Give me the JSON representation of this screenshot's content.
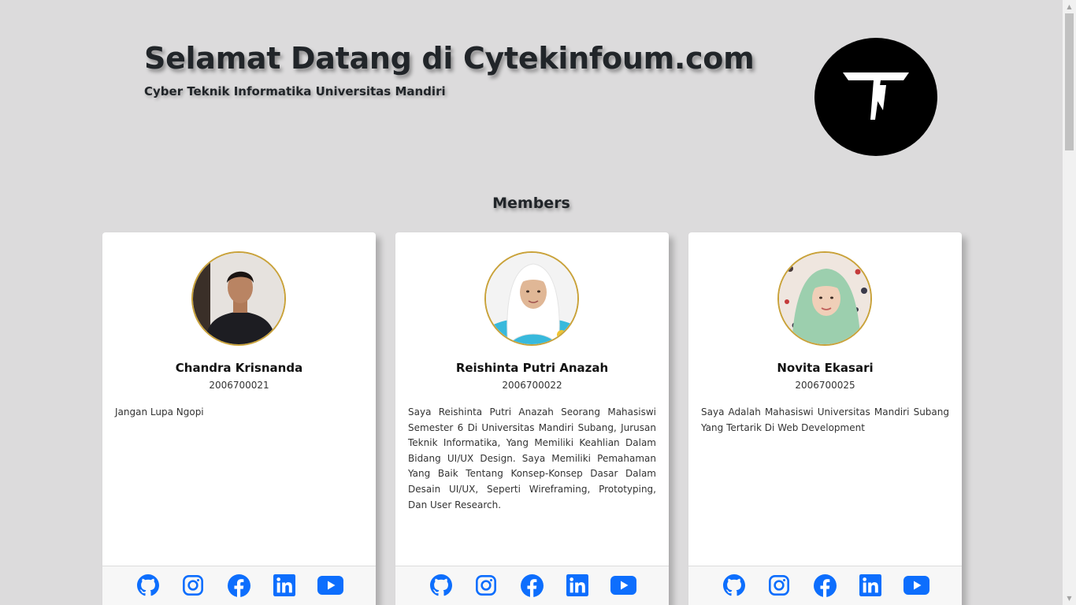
{
  "header": {
    "title": "Selamat Datang di Cytekinfoum.com",
    "subtitle": "Cyber Teknik Informatika Universitas Mandiri",
    "logo_icon": "ti-monogram-logo"
  },
  "members_section": {
    "title": "Members"
  },
  "members": [
    {
      "name": "Chandra Krisnanda",
      "nim": "2006700021",
      "bio": "Jangan Lupa Ngopi",
      "avatar": "photo-man-black-shirt"
    },
    {
      "name": "Reishinta Putri Anazah",
      "nim": "2006700022",
      "bio": "Saya Reishinta Putri Anazah Seorang Mahasiswi Semester 6 Di Universitas Mandiri Subang, Jurusan Teknik Informatika, Yang Memiliki Keahlian Dalam Bidang UI/UX Design. Saya Memiliki Pemahaman Yang Baik Tentang Konsep-Konsep Dasar Dalam Desain UI/UX, Seperti Wireframing, Prototyping, Dan User Research.",
      "avatar": "photo-woman-white-hijab"
    },
    {
      "name": "Novita Ekasari",
      "nim": "2006700025",
      "bio": "Saya Adalah Mahasiswi Universitas Mandiri Subang Yang Tertarik Di Web Development",
      "avatar": "photo-woman-green-hijab"
    }
  ],
  "social_icons": [
    "github-icon",
    "instagram-icon",
    "facebook-icon",
    "linkedin-icon",
    "youtube-icon"
  ],
  "colors": {
    "background": "#dcdbdc",
    "social_blue": "#0d6efd",
    "avatar_border": "#c9a23a",
    "card": "#ffffff"
  }
}
